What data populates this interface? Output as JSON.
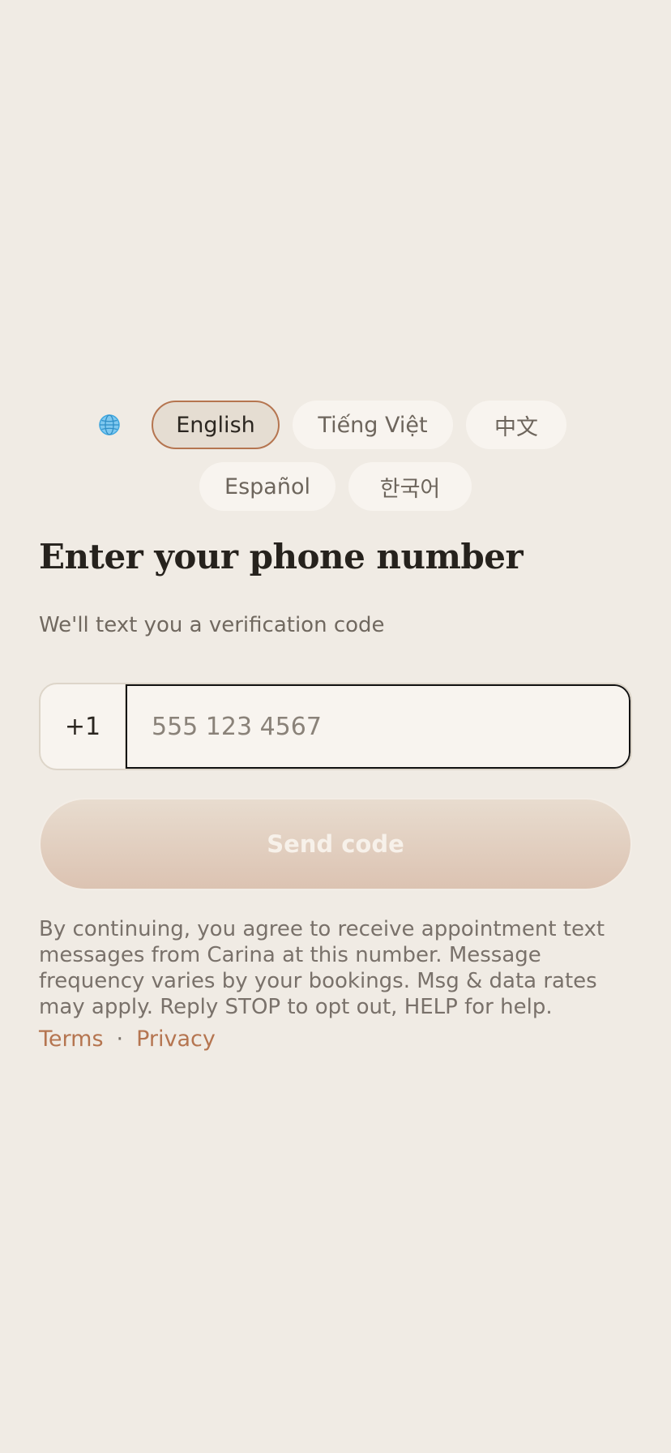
{
  "languages": {
    "options": [
      "English",
      "Tiếng Việt",
      "中文",
      "Español",
      "한국어"
    ],
    "selected": "English",
    "icon": "globe-icon"
  },
  "heading": {
    "title": "Enter your phone number",
    "subtitle": "We'll text you a verification code"
  },
  "phone": {
    "country_code": "+1",
    "placeholder": "555 123 4567",
    "value": ""
  },
  "send_button": {
    "label": "Send code"
  },
  "consent": {
    "text": "By continuing, you agree to receive appointment text messages from Carina at this number. Message frequency varies by your bookings. Msg & data rates may apply. Reply STOP to opt out, HELP for help."
  },
  "legal": {
    "terms_label": "Terms",
    "separator": "·",
    "privacy_label": "Privacy"
  },
  "colors": {
    "background": "#f0ebe4",
    "accent": "#b57550",
    "button_bg": "#e2d1c3"
  }
}
